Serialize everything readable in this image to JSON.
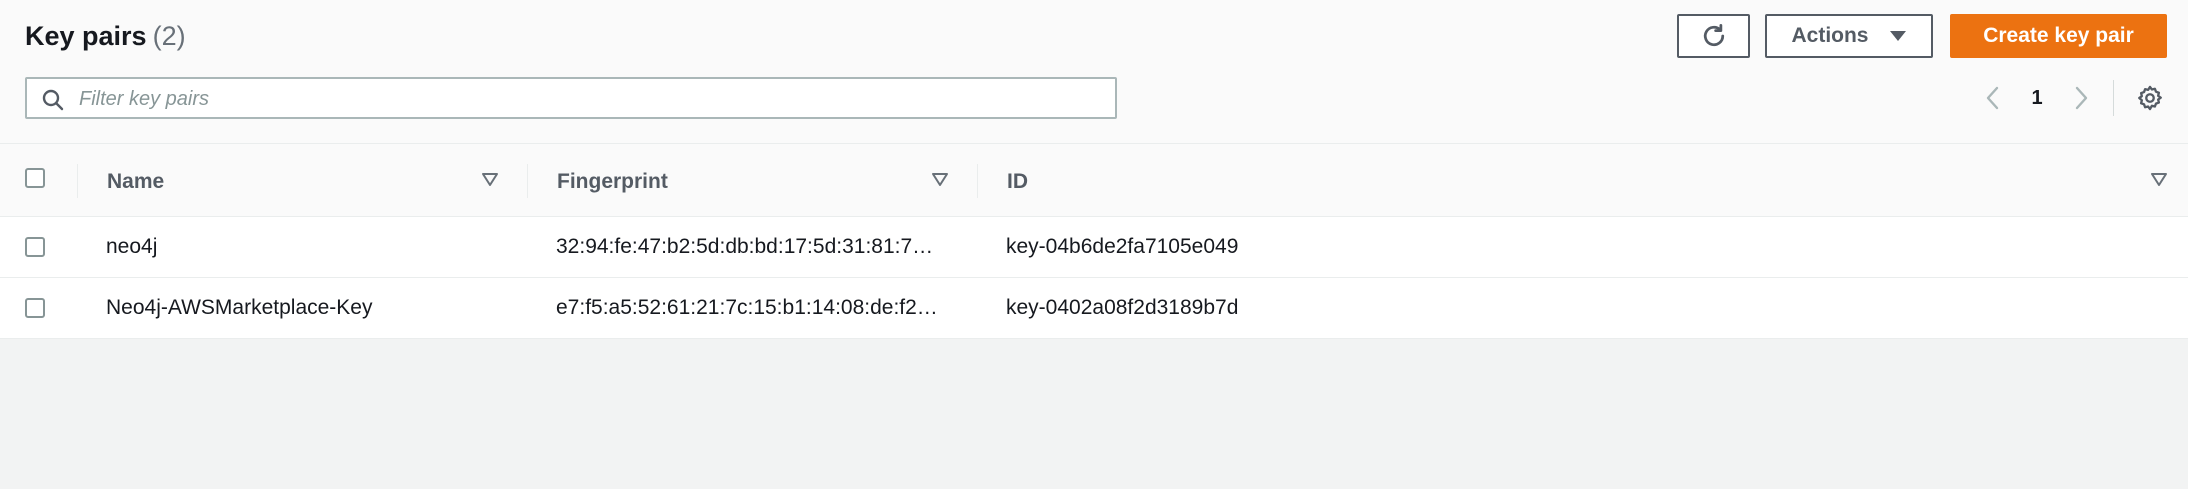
{
  "page": {
    "title": "Key pairs",
    "count": "(2)"
  },
  "toolbar": {
    "refresh_icon": "refresh-icon",
    "actions_label": "Actions",
    "create_label": "Create key pair"
  },
  "filter": {
    "placeholder": "Filter key pairs",
    "value": ""
  },
  "pagination": {
    "current_page": "1"
  },
  "table": {
    "columns": [
      {
        "label": "Name"
      },
      {
        "label": "Fingerprint"
      },
      {
        "label": "ID"
      }
    ],
    "rows": [
      {
        "name": "neo4j",
        "fingerprint": "32:94:fe:47:b2:5d:db:bd:17:5d:31:81:7…",
        "id": "key-04b6de2fa7105e049"
      },
      {
        "name": "Neo4j-AWSMarketplace-Key",
        "fingerprint": "e7:f5:a5:52:61:21:7c:15:b1:14:08:de:f2…",
        "id": "key-0402a08f2d3189b7d"
      }
    ]
  },
  "colors": {
    "primary": "#ec7211",
    "text": "#16191f",
    "muted": "#545b64",
    "border": "#aab7b8"
  }
}
